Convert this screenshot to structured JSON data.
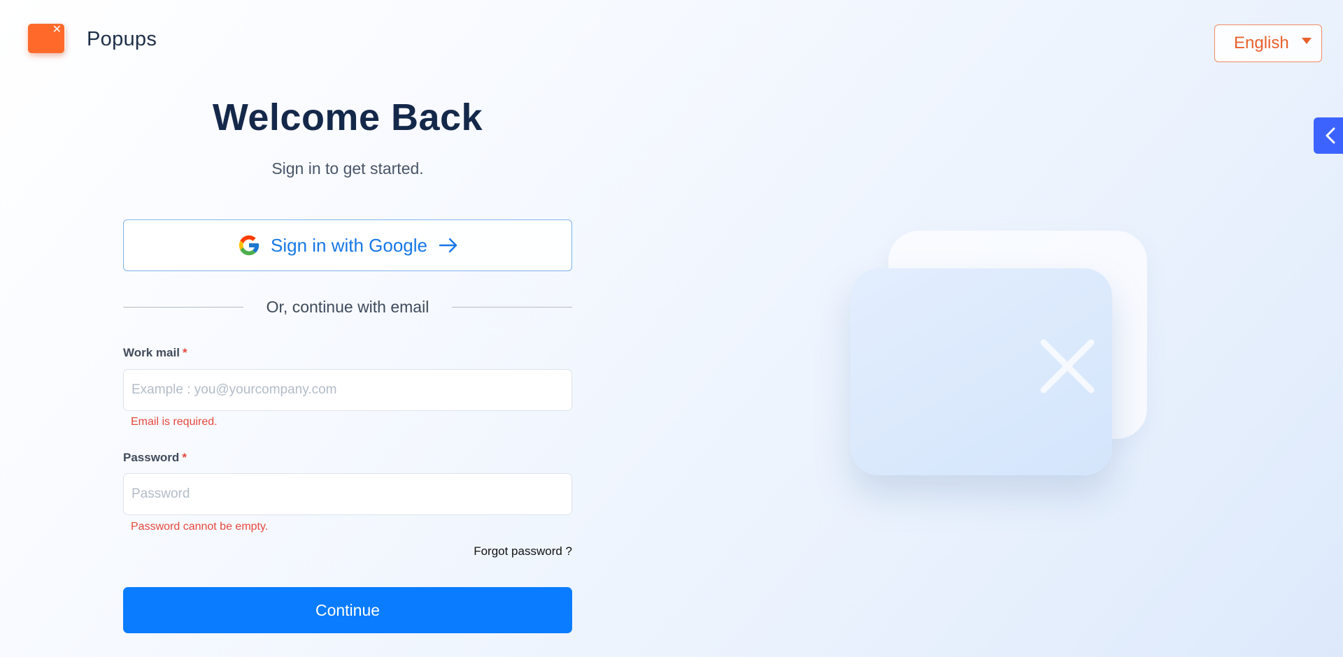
{
  "header": {
    "brand": "Popups",
    "language": "English"
  },
  "login": {
    "title": "Welcome Back",
    "subtitle": "Sign in to get started.",
    "google_button": "Sign in with Google",
    "divider": "Or, continue with email",
    "email": {
      "label": "Work mail",
      "required_mark": "*",
      "placeholder": "Example : you@yourcompany.com",
      "value": "",
      "error": "Email is required."
    },
    "password": {
      "label": "Password",
      "required_mark": "*",
      "placeholder": "Password",
      "value": "",
      "error": "Password cannot be empty."
    },
    "forgot": "Forgot password ?",
    "continue": "Continue"
  },
  "icons": {
    "logo": "popup-logo-icon",
    "language_caret": "caret-down-icon",
    "side_toggle": "chevron-left-icon",
    "google": "google-icon",
    "arrow": "arrow-right-icon",
    "illustration_close": "close-icon"
  },
  "colors": {
    "brand_orange": "#ff6a2b",
    "primary_blue": "#0a7cff",
    "google_text": "#1677e6",
    "error": "#e5483b",
    "title": "#14284a",
    "side_toggle": "#3d63ff"
  }
}
